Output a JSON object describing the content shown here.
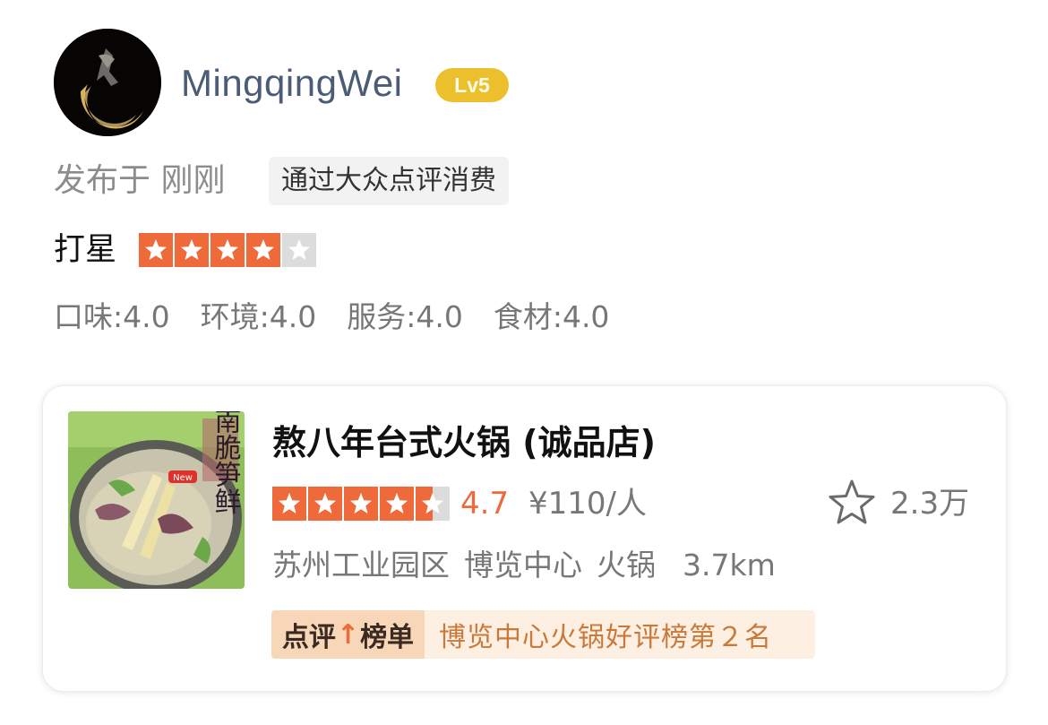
{
  "user": {
    "name": "MingqingWei",
    "level": "Lv5"
  },
  "post": {
    "time_text": "发布于 刚刚",
    "via_tag": "通过大众点评消费"
  },
  "rating": {
    "label": "打星",
    "stars": 4,
    "max_stars": 5
  },
  "subscores": [
    {
      "text": "口味:4.0"
    },
    {
      "text": "环境:4.0"
    },
    {
      "text": "服务:4.0"
    },
    {
      "text": "食材:4.0"
    }
  ],
  "shop": {
    "name": "熬八年台式火锅 (诚品店)",
    "stars": 4.5,
    "score": "4.7",
    "price": "¥110/人",
    "favorites": "2.3万",
    "area": "苏州工业园区",
    "district": "博览中心",
    "category": "火锅",
    "distance": "3.7km",
    "rank_label_left": "点评",
    "rank_label_right": "榜单",
    "rank_text": "博览中心火锅好评榜第２名",
    "image_text": "江南脆笋鲜",
    "image_badge": "New"
  },
  "colors": {
    "accent": "#ef6a3a",
    "username": "#4a5c76",
    "level_badge": "#ecc02c",
    "muted_text": "#777777"
  },
  "icons": [
    "star-icon",
    "favorite-star-icon",
    "rank-up-arrow-icon"
  ]
}
